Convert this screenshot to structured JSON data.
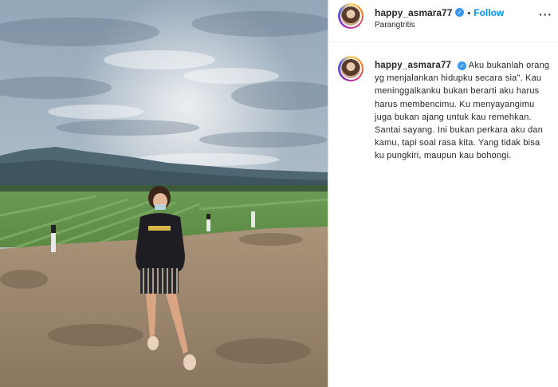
{
  "post": {
    "username": "happy_asmara77",
    "location": "Parangtritis",
    "follow_label": "Follow",
    "separator": "•",
    "more_label": "···",
    "caption": "Aku bukanlah orang yg menjalankan hidupku secara sia\". Kau meninggalkanku bukan berarti aku harus harus membencimu. Ku menyayangimu juga bukan ajang untuk kau remehkan. Santai sayang. Ini bukan perkara aku dan kamu, tapi soal rasa kita. Yang tidak bisa ku pungkiri, maupun kau bohongi.",
    "photo_sweater_text": "ADIDAS"
  },
  "icons": {
    "verified": "verified-badge-icon",
    "more": "more-options-icon"
  },
  "colors": {
    "follow": "#0095f6",
    "verified": "#3897f0",
    "text": "#262626",
    "border": "#dbdbdb"
  }
}
